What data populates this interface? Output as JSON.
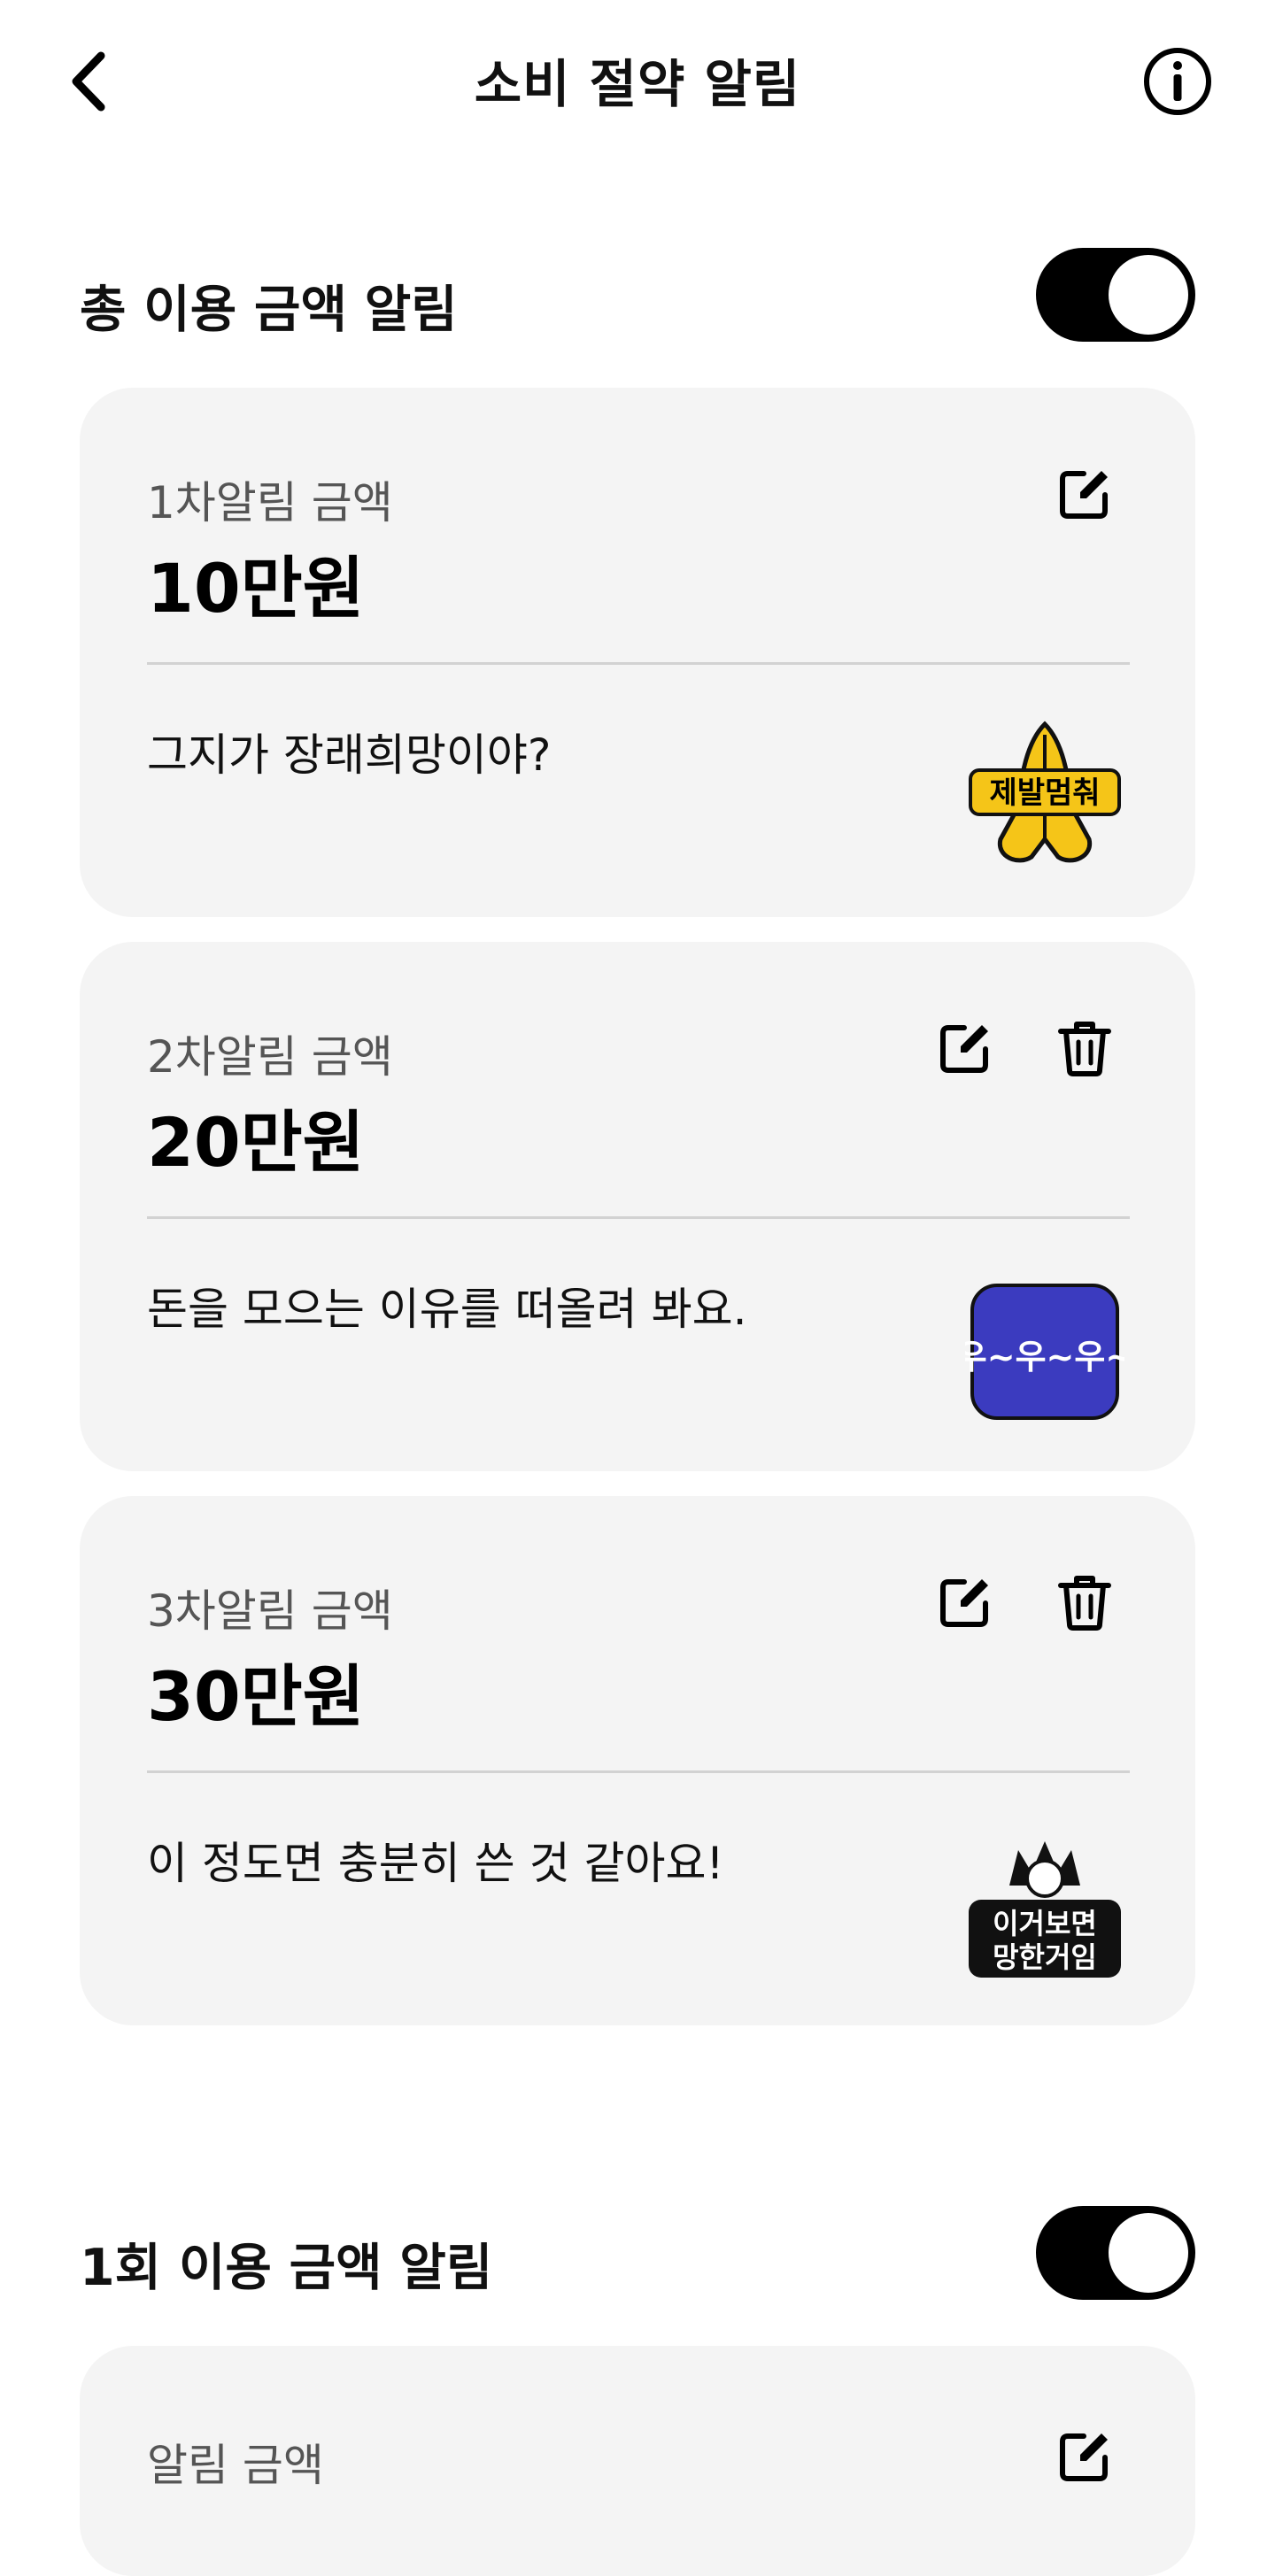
{
  "header": {
    "title": "소비 절약 알림"
  },
  "total_alert": {
    "title": "총 이용 금액 알림",
    "enabled": true,
    "cards": [
      {
        "label": "1차알림 금액",
        "amount": "10만원",
        "message": "그지가 장래희망이야?",
        "sticker_text": "제발멈춰",
        "deletable": false
      },
      {
        "label": "2차알림 금액",
        "amount": "20만원",
        "message": "돈을 모으는 이유를 떠올려 봐요.",
        "sticker_text": "우~우~우~",
        "deletable": true
      },
      {
        "label": "3차알림 금액",
        "amount": "30만원",
        "message": "이 정도면 충분히 쓴 것 같아요!",
        "sticker_text_1": "이거보면",
        "sticker_text_2": "망한거임",
        "deletable": true
      }
    ]
  },
  "single_alert": {
    "title": "1회 이용 금액 알림",
    "enabled": true,
    "card": {
      "label": "알림 금액"
    }
  },
  "colors": {
    "toggle_on": "#000000",
    "card_bg": "#f4f4f4",
    "sticker_yellow": "#f5c518",
    "sticker_blue": "#3b3bbf"
  },
  "icons": {
    "back": "chevron-left-icon",
    "info": "info-circle-icon",
    "edit": "edit-square-icon",
    "delete": "trash-icon"
  }
}
